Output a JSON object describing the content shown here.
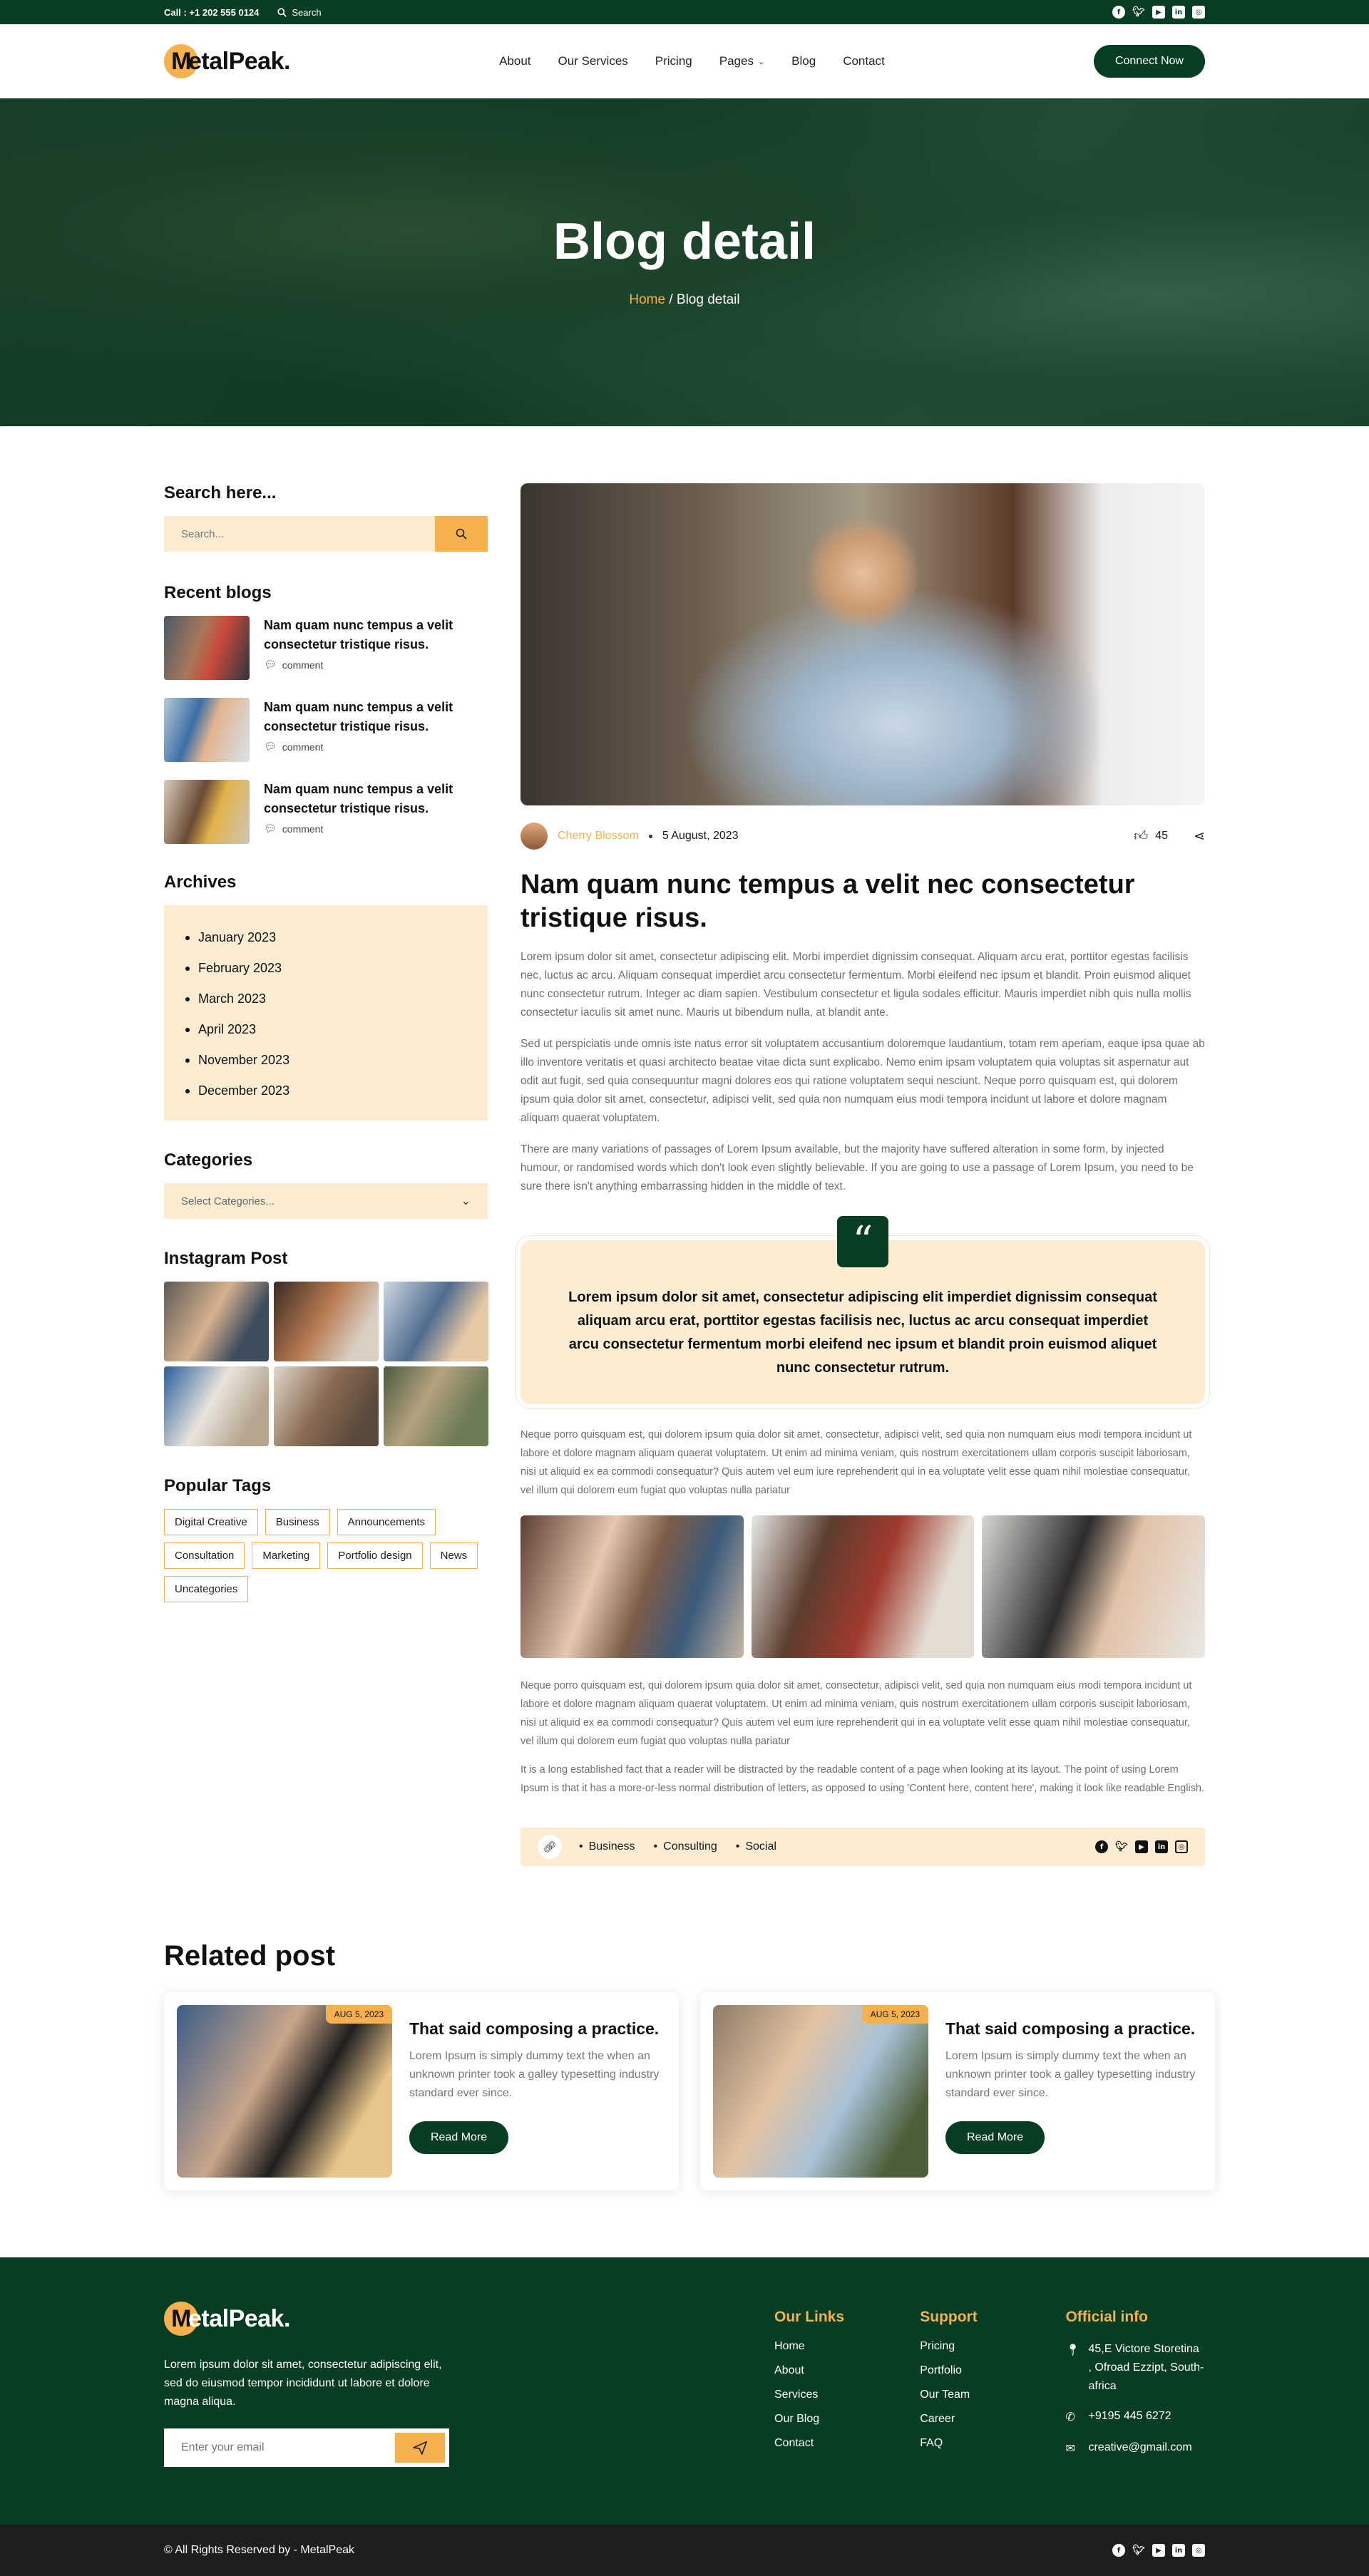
{
  "topbar": {
    "call_label": "Call :",
    "phone": "+1 202 555 0124",
    "search_label": "Search",
    "social": [
      "facebook-icon",
      "twitter-icon",
      "youtube-icon",
      "linkedin-icon",
      "instagram-icon"
    ]
  },
  "header": {
    "logo_letter": "M",
    "logo_text": "etalPeak.",
    "nav": [
      "About",
      "Our Services",
      "Pricing",
      "Pages",
      "Blog",
      "Contact"
    ],
    "cta": "Connect Now"
  },
  "hero": {
    "title": "Blog detail",
    "crumb_home": "Home",
    "crumb_sep": " / ",
    "crumb_current": "Blog detail"
  },
  "sidebar": {
    "search_title": "Search here...",
    "search_placeholder": "Search...",
    "recent_title": "Recent blogs",
    "recent": [
      {
        "title": "Nam quam nunc tempus a velit consectetur tristique risus.",
        "comment": "comment"
      },
      {
        "title": "Nam quam nunc tempus a velit consectetur tristique risus.",
        "comment": "comment"
      },
      {
        "title": "Nam quam nunc tempus a velit consectetur tristique risus.",
        "comment": "comment"
      }
    ],
    "archives_title": "Archives",
    "archives": [
      "January 2023",
      "February 2023",
      "March 2023",
      "April 2023",
      "November 2023",
      "December 2023"
    ],
    "categories_title": "Categories",
    "categories_select": "Select Categories...",
    "instagram_title": "Instagram Post",
    "tags_title": "Popular Tags",
    "tags": [
      "Digital Creative",
      "Business",
      "Announcements",
      "Consultation",
      "Marketing",
      "Portfolio design",
      "News",
      "Uncategories"
    ]
  },
  "post": {
    "author": "Cherry Blossom",
    "date": "5 August, 2023",
    "likes": "45",
    "title": "Nam quam nunc tempus a velit nec consectetur tristique risus.",
    "p1": "Lorem ipsum dolor sit amet, consectetur adipiscing elit. Morbi imperdiet dignissim consequat. Aliquam arcu erat, porttitor egestas facilisis nec, luctus ac arcu. Aliquam consequat imperdiet arcu consectetur fermentum. Morbi eleifend nec ipsum et blandit. Proin euismod aliquet nunc consectetur rutrum. Integer ac diam sapien. Vestibulum consectetur et ligula sodales efficitur. Mauris imperdiet nibh quis nulla mollis consectetur iaculis sit amet nunc. Mauris ut bibendum nulla, at blandit ante.",
    "p2": "Sed ut perspiciatis unde omnis iste natus error sit voluptatem accusantium doloremque laudantium, totam rem aperiam, eaque ipsa quae ab illo inventore veritatis et quasi architecto beatae vitae dicta sunt explicabo. Nemo enim ipsam voluptatem quia voluptas sit aspernatur aut odit aut fugit, sed quia consequuntur magni dolores eos qui ratione voluptatem sequi nesciunt. Neque porro quisquam est, qui dolorem ipsum quia dolor sit amet, consectetur, adipisci velit, sed quia non numquam eius modi tempora incidunt ut labore et dolore magnam aliquam quaerat voluptatem.",
    "p3": "There are many variations of passages of Lorem Ipsum available, but the majority have suffered alteration in some form, by injected humour, or randomised words which don't look even slightly believable. If you are going to use a passage of Lorem Ipsum, you need to be sure there isn't anything embarrassing hidden in the middle of text.",
    "quote": "Lorem ipsum dolor sit amet, consectetur adipiscing elit imperdiet dignissim consequat aliquam arcu erat, porttitor egestas facilisis nec, luctus ac arcu consequat imperdiet arcu consectetur fermentum morbi eleifend nec ipsum et blandit proin euismod aliquet nunc consectetur rutrum.",
    "quote_mark": "“",
    "p4": "Neque porro quisquam est, qui dolorem ipsum quia dolor sit amet, consectetur, adipisci velit, sed quia non numquam eius modi tempora incidunt ut labore et dolore magnam aliquam quaerat voluptatem. Ut enim ad minima veniam, quis nostrum exercitationem ullam corporis suscipit laboriosam, nisi ut aliquid ex ea commodi consequatur? Quis autem vel eum iure reprehenderit qui in ea voluptate velit esse quam nihil molestiae consequatur, vel illum qui dolorem eum fugiat quo voluptas nulla pariatur",
    "p5": "Neque porro quisquam est, qui dolorem ipsum quia dolor sit amet, consectetur, adipisci velit, sed quia non numquam eius modi tempora incidunt ut labore et dolore magnam aliquam quaerat voluptatem. Ut enim ad minima veniam, quis nostrum exercitationem ullam corporis suscipit laboriosam, nisi ut aliquid ex ea commodi consequatur? Quis autem vel eum iure reprehenderit qui in ea voluptate velit esse quam nihil molestiae consequatur, vel illum qui dolorem eum fugiat quo voluptas nulla pariatur",
    "p6": "It is a long established fact that a reader will be distracted by the readable content of a page when looking at its layout. The point of using Lorem Ipsum is that it has a more-or-less normal distribution of letters, as opposed to using 'Content here, content here', making it look like readable English.",
    "post_tags": [
      "Business",
      "Consulting",
      "Social"
    ]
  },
  "related": {
    "title": "Related post",
    "cards": [
      {
        "date": "AUG 5, 2023",
        "title": "That said composing a practice.",
        "text": "Lorem Ipsum is simply dummy text the when an unknown printer took a galley typesetting industry standard ever since.",
        "button": "Read More"
      },
      {
        "date": "AUG 5, 2023",
        "title": "That said composing a practice.",
        "text": "Lorem Ipsum is simply dummy text the when an unknown printer took a galley typesetting industry standard ever since.",
        "button": "Read More"
      }
    ]
  },
  "footer": {
    "desc": "Lorem ipsum dolor sit amet, consectetur adipiscing elit, sed do eiusmod tempor incididunt ut labore et dolore magna aliqua.",
    "email_placeholder": "Enter your email",
    "links_title": "Our Links",
    "links": [
      "Home",
      "About",
      "Services",
      "Our Blog",
      "Contact"
    ],
    "support_title": "Support",
    "support": [
      "Pricing",
      "Portfolio",
      "Our Team",
      "Career",
      "FAQ"
    ],
    "info_title": "Official info",
    "address": "45,E Victore Storetina , Ofroad Ezzipt, South-africa",
    "phone": "+9195 445 6272",
    "email": "creative@gmail.com",
    "copyright": "© All Rights Reserved by - MetalPeak"
  },
  "colors": {
    "primary_green": "#063d23",
    "accent_orange": "#f6b04d",
    "cream": "#fcecd2"
  }
}
